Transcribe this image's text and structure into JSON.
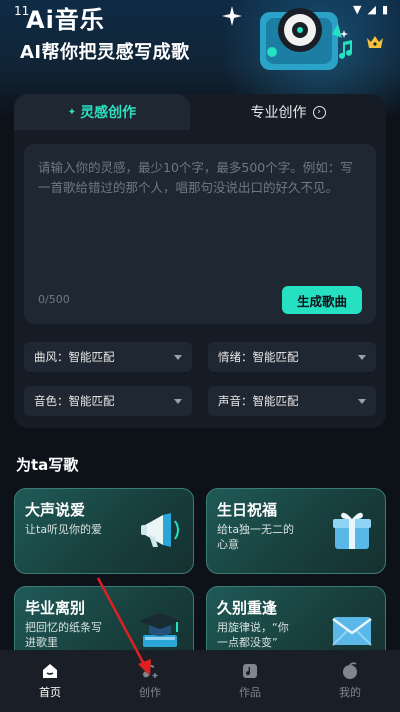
{
  "status_bar": {
    "time": "11"
  },
  "header": {
    "title": "Ai音乐",
    "subtitle": "AI帮你把灵感写成歌"
  },
  "tabs": {
    "inspiration": "灵感创作",
    "professional": "专业创作"
  },
  "prompt": {
    "placeholder": "请输入你的灵感，最少10个字，最多500个字。例如：写一首歌给错过的那个人，唱那句没说出口的好久不见。",
    "counter": "0/500",
    "generate_label": "生成歌曲"
  },
  "selects": {
    "style": "曲风：智能匹配",
    "mood": "情绪：智能匹配",
    "timbre": "音色：智能匹配",
    "voice": "声音：智能匹配"
  },
  "section": {
    "title": "为ta写歌"
  },
  "cards": [
    {
      "title": "大声说爱",
      "desc": "让ta听见你的爱"
    },
    {
      "title": "生日祝福",
      "desc": "给ta独一无二的心意"
    },
    {
      "title": "毕业离别",
      "desc": "把回忆的纸条写进歌里"
    },
    {
      "title": "久别重逢",
      "desc": "用旋律说，“你一点都没变”"
    }
  ],
  "nav": {
    "home": "首页",
    "create": "创作",
    "works": "作品",
    "mine": "我的"
  },
  "colors": {
    "accent": "#25e0c1",
    "background": "#0d1118",
    "panel": "#161c25",
    "annotation_arrow": "#e02020"
  }
}
